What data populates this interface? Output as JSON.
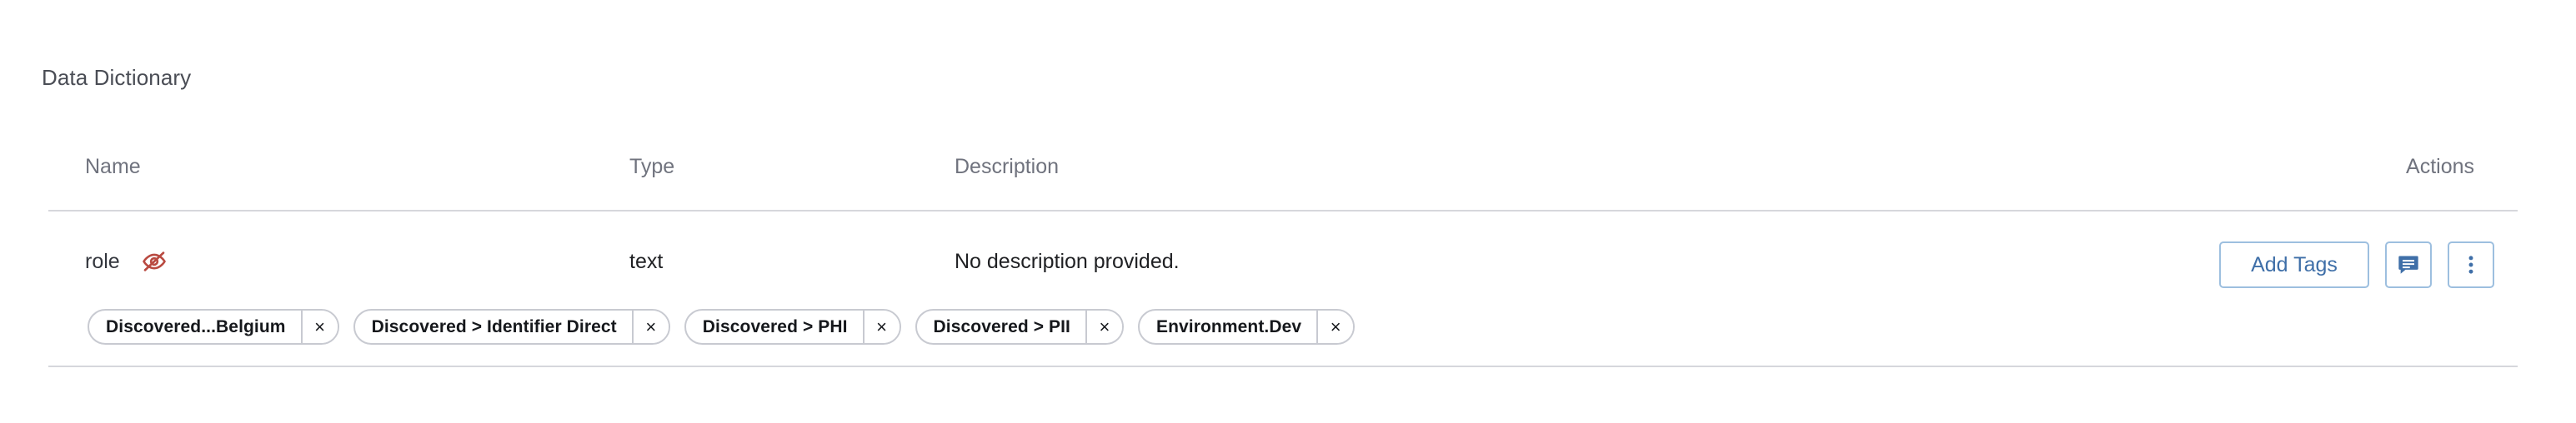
{
  "section": {
    "title": "Data Dictionary"
  },
  "table": {
    "columns": [
      {
        "key": "name",
        "label": "Name"
      },
      {
        "key": "type",
        "label": "Type"
      },
      {
        "key": "description",
        "label": "Description"
      },
      {
        "key": "actions",
        "label": "Actions"
      }
    ],
    "rows": [
      {
        "name": "role",
        "name_status_icon": "eye-off-icon",
        "name_status_color": "#b94a41",
        "type": "text",
        "description": "No description provided.",
        "actions": {
          "add_tags_label": "Add Tags",
          "comment_icon": "comment-icon",
          "more_icon": "more-vertical-icon"
        },
        "tags": [
          {
            "label": "Discovered...Belgium",
            "remove": "×"
          },
          {
            "label": "Discovered > Identifier Direct",
            "remove": "×"
          },
          {
            "label": "Discovered > PHI",
            "remove": "×"
          },
          {
            "label": "Discovered > PII",
            "remove": "×"
          },
          {
            "label": "Environment.Dev",
            "remove": "×"
          }
        ]
      }
    ]
  },
  "colors": {
    "accent_blue": "#3f6fa8",
    "button_border": "#9dbfdf",
    "divider": "#d6d7dc",
    "header_text": "#70737e",
    "body_text": "#1f2023",
    "tag_border": "#c8cad1",
    "status_red": "#b94a41"
  }
}
